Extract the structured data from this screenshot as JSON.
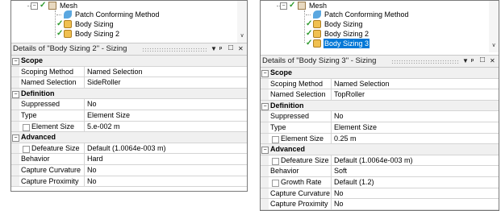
{
  "panels": {
    "left": {
      "tree": {
        "root": "Mesh",
        "items": [
          {
            "label": "Patch Conforming Method",
            "selected": false
          },
          {
            "label": "Body Sizing",
            "selected": false
          },
          {
            "label": "Body Sizing 2",
            "selected": false
          }
        ]
      },
      "details": {
        "title": "Details of \"Body Sizing 2\" - Sizing",
        "controls": {
          "dropdown": "▼",
          "pin": "ᵖ",
          "maximize": "□",
          "close": "✕"
        },
        "categories": [
          {
            "label": "Scope",
            "rows": [
              {
                "name": "Scoping Method",
                "value": "Named Selection",
                "checkbox": false
              },
              {
                "name": "Named Selection",
                "value": "SideRoller",
                "checkbox": false
              }
            ]
          },
          {
            "label": "Definition",
            "rows": [
              {
                "name": "Suppressed",
                "value": "No",
                "checkbox": false
              },
              {
                "name": "Type",
                "value": "Element Size",
                "checkbox": false
              },
              {
                "name": "Element Size",
                "value": "5.e-002 m",
                "checkbox": true
              }
            ]
          },
          {
            "label": "Advanced",
            "rows": [
              {
                "name": "Defeature Size",
                "value": "Default (1.0064e-003 m)",
                "checkbox": true
              },
              {
                "name": "Behavior",
                "value": "Hard",
                "checkbox": false
              },
              {
                "name": "Capture Curvature",
                "value": "No",
                "checkbox": false
              },
              {
                "name": "Capture Proximity",
                "value": "No",
                "checkbox": false
              }
            ]
          }
        ]
      }
    },
    "right": {
      "tree": {
        "root": "Mesh",
        "items": [
          {
            "label": "Patch Conforming Method",
            "selected": false
          },
          {
            "label": "Body Sizing",
            "selected": false
          },
          {
            "label": "Body Sizing 2",
            "selected": false
          },
          {
            "label": "Body Sizing 3",
            "selected": true
          }
        ]
      },
      "details": {
        "title": "Details of \"Body Sizing 3\" - Sizing",
        "controls": {
          "dropdown": "▼",
          "pin": "ᵖ",
          "maximize": "□",
          "close": "✕"
        },
        "categories": [
          {
            "label": "Scope",
            "rows": [
              {
                "name": "Scoping Method",
                "value": "Named Selection",
                "checkbox": false
              },
              {
                "name": "Named Selection",
                "value": "TopRoller",
                "checkbox": false
              }
            ]
          },
          {
            "label": "Definition",
            "rows": [
              {
                "name": "Suppressed",
                "value": "No",
                "checkbox": false
              },
              {
                "name": "Type",
                "value": "Element Size",
                "checkbox": false
              },
              {
                "name": "Element Size",
                "value": "0.25 m",
                "checkbox": true
              }
            ]
          },
          {
            "label": "Advanced",
            "rows": [
              {
                "name": "Defeature Size",
                "value": "Default (1.0064e-003 m)",
                "checkbox": true
              },
              {
                "name": "Behavior",
                "value": "Soft",
                "checkbox": false
              },
              {
                "name": "Growth Rate",
                "value": "Default (1.2)",
                "checkbox": true
              },
              {
                "name": "Capture Curvature",
                "value": "No",
                "checkbox": false
              },
              {
                "name": "Capture Proximity",
                "value": "No",
                "checkbox": false
              }
            ]
          }
        ]
      }
    }
  }
}
